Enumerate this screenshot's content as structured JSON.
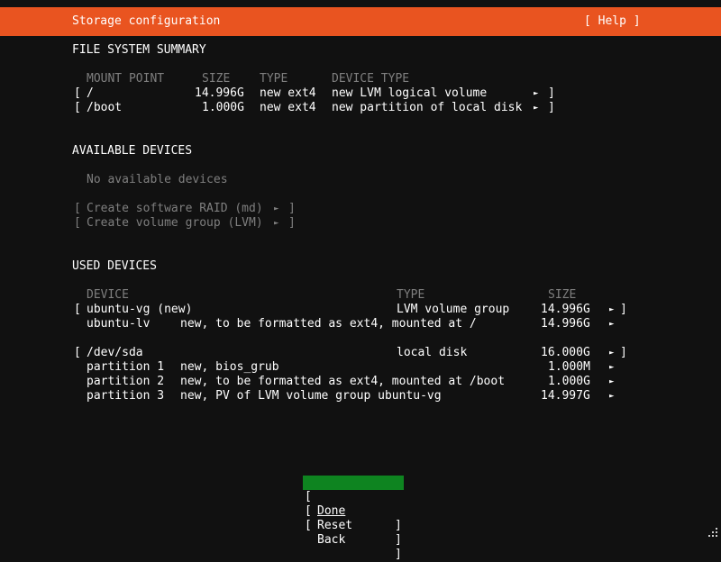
{
  "header": {
    "title": "Storage configuration",
    "help_label": "[ Help ]",
    "color": "#e95420"
  },
  "fs_summary": {
    "heading": "FILE SYSTEM SUMMARY",
    "columns": {
      "mount": "MOUNT POINT",
      "size": "SIZE",
      "type": "TYPE",
      "device_type": "DEVICE TYPE"
    },
    "rows": [
      {
        "mount": "/",
        "size": "14.996G",
        "type": "new ext4",
        "device_type": "new LVM logical volume"
      },
      {
        "mount": "/boot",
        "size": "1.000G",
        "type": "new ext4",
        "device_type": "new partition of local disk"
      }
    ]
  },
  "available": {
    "heading": "AVAILABLE DEVICES",
    "empty_text": "No available devices",
    "actions": [
      {
        "label": "Create software RAID (md)"
      },
      {
        "label": "Create volume group (LVM)"
      }
    ]
  },
  "used": {
    "heading": "USED DEVICES",
    "columns": {
      "device": "DEVICE",
      "type": "TYPE",
      "size": "SIZE"
    },
    "groups": [
      {
        "device": "ubuntu-vg (new)",
        "type": "LVM volume group",
        "size": "14.996G",
        "children": [
          {
            "name": "ubuntu-lv",
            "desc": "new, to be formatted as ext4, mounted at /",
            "size": "14.996G"
          }
        ]
      },
      {
        "device": "/dev/sda",
        "type": "local disk",
        "size": "16.000G",
        "children": [
          {
            "name": "partition 1",
            "desc": "new, bios_grub",
            "size": "1.000M"
          },
          {
            "name": "partition 2",
            "desc": "new, to be formatted as ext4, mounted at /boot",
            "size": "1.000G"
          },
          {
            "name": "partition 3",
            "desc": "new, PV of LVM volume group ubuntu-vg",
            "size": "14.997G"
          }
        ]
      }
    ]
  },
  "buttons": {
    "done": "Done",
    "reset": "Reset",
    "back": "Back",
    "focus_color": "#0e8420"
  },
  "glyphs": {
    "arrow": "►",
    "open": "[",
    "close": "]"
  }
}
